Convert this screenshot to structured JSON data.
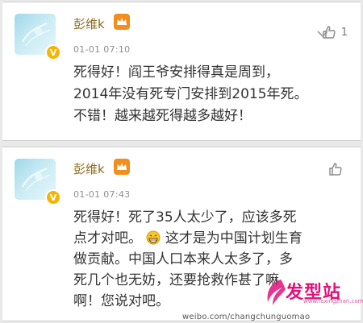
{
  "comments": [
    {
      "username": "彭维k",
      "time": "01-01 07:10",
      "likes": "1",
      "lines": [
        "死得好！阎王爷安排得真是周到，",
        "2014年没有死专门安排到2015年死。",
        "不错！越来越死得越多越好！"
      ]
    },
    {
      "username": "彭维k",
      "time": "01-01 07:43",
      "likes": "",
      "lines": [
        "死得好！死了35人太少了，应该多死",
        "点才对吧。",
        "这才是为中国计划生育",
        "做贡献。中国人口本来人太多了，多",
        "死几个也无妨，还要抢救作甚了嘛",
        "啊！您说对吧。"
      ]
    }
  ],
  "badge": {
    "verified": "V"
  },
  "watermark": {
    "brand": "发型站",
    "site": "www.faxingzhan.com"
  },
  "source_url": "weibo.com/changchunguomao",
  "icons": {
    "like": "thumbs-up-icon",
    "menu": "chevron-down-icon",
    "vip": "crown-badge-icon",
    "emoji": "grin-emoji-icon"
  },
  "colors": {
    "username": "#8a6a1c",
    "time": "#8d8d8d",
    "text": "#333333",
    "watermark": "#e0127a",
    "vip": "#f28e1d"
  }
}
